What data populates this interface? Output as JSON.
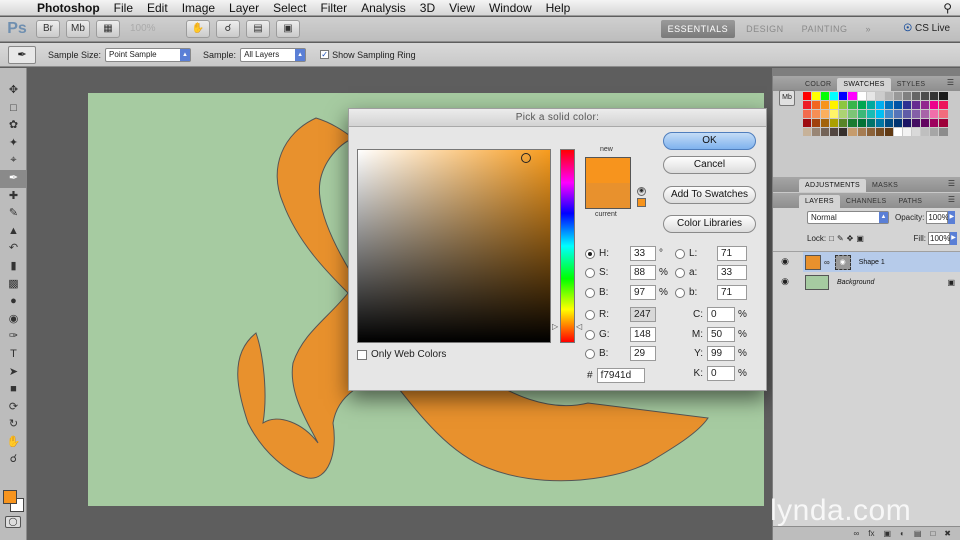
{
  "menubar": {
    "apple_icon": "apple-icon",
    "app_name": "Photoshop",
    "items": [
      "File",
      "Edit",
      "Image",
      "Layer",
      "Select",
      "Filter",
      "Analysis",
      "3D",
      "View",
      "Window",
      "Help"
    ]
  },
  "appbar": {
    "logo": "Ps",
    "zoom_value": "100%",
    "workspaces": [
      "ESSENTIALS",
      "DESIGN",
      "PAINTING"
    ],
    "more": "»",
    "cslive": "CS Live"
  },
  "options": {
    "tool_icon": "eyedropper-icon",
    "sample_size_label": "Sample Size:",
    "sample_size_value": "Point Sample",
    "sample_label": "Sample:",
    "sample_value": "All Layers",
    "sampling_ring_label": "Show Sampling Ring",
    "sampling_ring_checked": true
  },
  "toolbox": {
    "tools": [
      "move-icon",
      "marquee-icon",
      "lasso-icon",
      "quick-select-icon",
      "crop-icon",
      "eyedropper-icon",
      "healing-icon",
      "brush-icon",
      "stamp-icon",
      "history-brush-icon",
      "eraser-icon",
      "gradient-icon",
      "blur-icon",
      "dodge-icon",
      "pen-icon",
      "type-icon",
      "path-select-icon",
      "shape-icon",
      "3d-rotate-icon",
      "3d-orbit-icon",
      "hand-icon",
      "zoom-icon"
    ],
    "selected_index": 5,
    "foreground_color": "#f7941d",
    "background_color": "#ffffff"
  },
  "document": {
    "canvas_color": "#a6cba1",
    "shape_color": "#e8912d"
  },
  "picker": {
    "title": "Pick a solid color:",
    "new_label": "new",
    "current_label": "current",
    "new_color": "#f7941d",
    "current_color": "#e8912d",
    "buttons": {
      "ok": "OK",
      "cancel": "Cancel",
      "add_to_swatches": "Add To Swatches",
      "color_libraries": "Color Libraries"
    },
    "hsb": [
      {
        "label": "H:",
        "value": "33",
        "unit": "°",
        "selected": true
      },
      {
        "label": "S:",
        "value": "88",
        "unit": "%",
        "selected": false
      },
      {
        "label": "B:",
        "value": "97",
        "unit": "%",
        "selected": false
      }
    ],
    "lab": [
      {
        "label": "L:",
        "value": "71"
      },
      {
        "label": "a:",
        "value": "33"
      },
      {
        "label": "b:",
        "value": "71"
      }
    ],
    "rgb": [
      {
        "label": "R:",
        "value": "247"
      },
      {
        "label": "G:",
        "value": "148"
      },
      {
        "label": "B:",
        "value": "29"
      }
    ],
    "cmyk": [
      {
        "label": "C:",
        "value": "0",
        "unit": "%"
      },
      {
        "label": "M:",
        "value": "50",
        "unit": "%"
      },
      {
        "label": "Y:",
        "value": "99",
        "unit": "%"
      },
      {
        "label": "K:",
        "value": "0",
        "unit": "%"
      }
    ],
    "hex_label": "#",
    "hex_value": "f7941d",
    "web_colors_label": "Only Web Colors"
  },
  "panels": {
    "color_tabs": [
      "COLOR",
      "SWATCHES",
      "STYLES"
    ],
    "active_color_tab": "SWATCHES",
    "adjust_tabs": [
      "ADJUSTMENTS",
      "MASKS"
    ],
    "layers_tabs": [
      "LAYERS",
      "CHANNELS",
      "PATHS"
    ],
    "blend_mode": "Normal",
    "opacity_label": "Opacity:",
    "opacity_value": "100%",
    "lock_label": "Lock:",
    "fill_label": "Fill:",
    "fill_value": "100%",
    "layers": [
      {
        "name": "Shape 1",
        "thumb_color": "#e8912d",
        "selected": true
      },
      {
        "name": "Background",
        "thumb_color": "#a6cba1",
        "selected": false
      }
    ]
  },
  "watermark": "lynda.com"
}
